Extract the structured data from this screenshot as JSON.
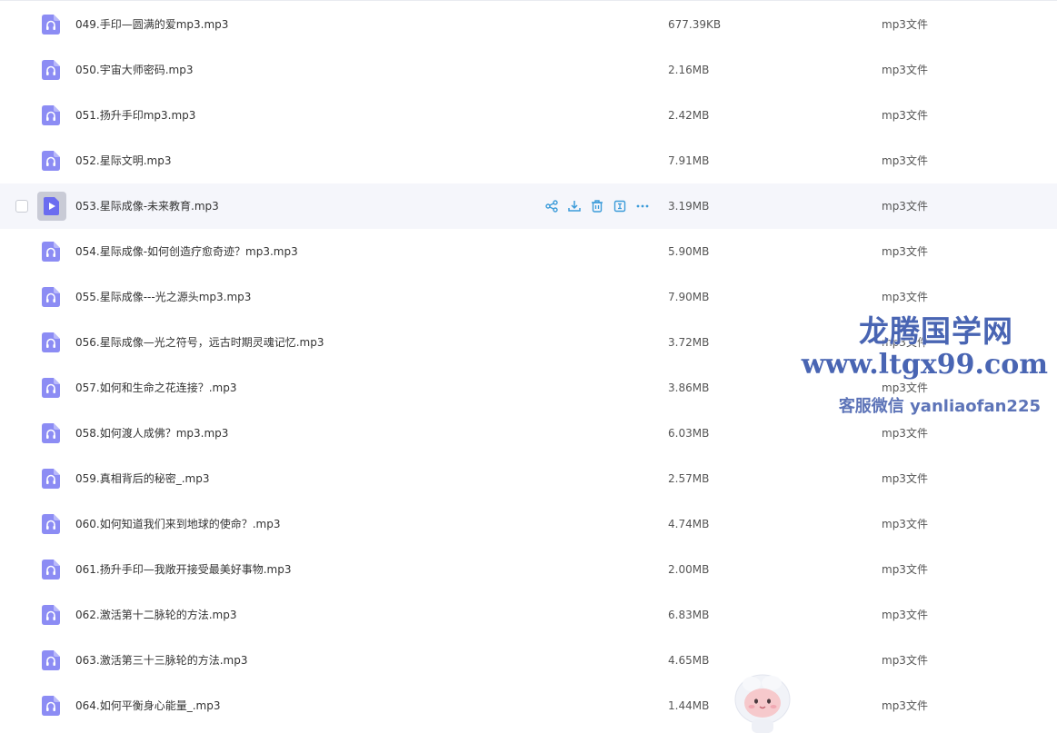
{
  "files": [
    {
      "name": "049.手印—圆满的爱mp3.mp3",
      "size": "677.39KB",
      "type": "mp3文件"
    },
    {
      "name": "050.宇宙大师密码.mp3",
      "size": "2.16MB",
      "type": "mp3文件"
    },
    {
      "name": "051.扬升手印mp3.mp3",
      "size": "2.42MB",
      "type": "mp3文件"
    },
    {
      "name": "052.星际文明.mp3",
      "size": "7.91MB",
      "type": "mp3文件"
    },
    {
      "name": "053.星际成像-未来教育.mp3",
      "size": "3.19MB",
      "type": "mp3文件"
    },
    {
      "name": "054.星际成像-如何创造疗愈奇迹？mp3.mp3",
      "size": "5.90MB",
      "type": "mp3文件"
    },
    {
      "name": "055.星际成像---光之源头mp3.mp3",
      "size": "7.90MB",
      "type": "mp3文件"
    },
    {
      "name": "056.星际成像—光之符号，远古时期灵魂记忆.mp3",
      "size": "3.72MB",
      "type": "mp3文件"
    },
    {
      "name": "057.如何和生命之花连接？.mp3",
      "size": "3.86MB",
      "type": "mp3文件"
    },
    {
      "name": "058.如何渡人成佛？mp3.mp3",
      "size": "6.03MB",
      "type": "mp3文件"
    },
    {
      "name": "059.真相背后的秘密_.mp3",
      "size": "2.57MB",
      "type": "mp3文件"
    },
    {
      "name": "060.如何知道我们来到地球的使命？.mp3",
      "size": "4.74MB",
      "type": "mp3文件"
    },
    {
      "name": "061.扬升手印—我敞开接受最美好事物.mp3",
      "size": "2.00MB",
      "type": "mp3文件"
    },
    {
      "name": "062.激活第十二脉轮的方法.mp3",
      "size": "6.83MB",
      "type": "mp3文件"
    },
    {
      "name": "063.激活第三十三脉轮的方法.mp3",
      "size": "4.65MB",
      "type": "mp3文件"
    },
    {
      "name": "064.如何平衡身心能量_.mp3",
      "size": "1.44MB",
      "type": "mp3文件"
    }
  ],
  "hover_index": 4,
  "icons": {
    "file": "audio-file-icon",
    "file_hover": "play-file-icon",
    "actions": [
      "share-icon",
      "download-icon",
      "delete-icon",
      "info-icon",
      "more-icon"
    ]
  },
  "watermark": {
    "title": "龙腾国学网",
    "url": "www.ltgx99.com",
    "contact": "客服微信 yanliaofan225"
  },
  "colors": {
    "icon_purple": "#8c8cf4",
    "action_blue": "#3b9bd9",
    "hover_bg": "#f5f6fb",
    "watermark": "#4965b3"
  }
}
